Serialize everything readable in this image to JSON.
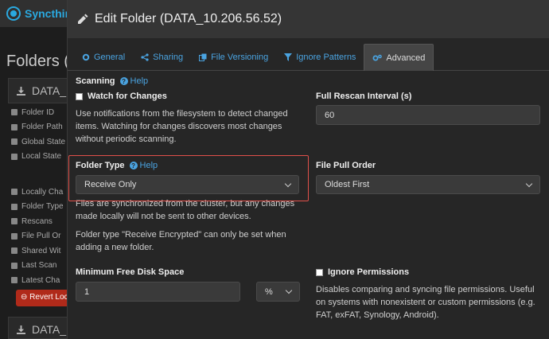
{
  "app": {
    "brand": "Syncthing"
  },
  "background": {
    "heading": "Folders (",
    "panel_title": "DATA_",
    "panel2_title": "DATA_",
    "items": [
      "Folder ID",
      "Folder Path",
      "Global State",
      "Local State",
      "Locally Cha",
      "Folder Type",
      "Rescans",
      "File Pull Or",
      "Shared Wit",
      "Last Scan",
      "Latest Cha"
    ],
    "revert_button": "Revert Loca"
  },
  "modal": {
    "title": "Edit Folder (DATA_10.206.56.52)",
    "tabs": [
      {
        "label": "General",
        "icon": "gear-icon"
      },
      {
        "label": "Sharing",
        "icon": "share-icon"
      },
      {
        "label": "File Versioning",
        "icon": "versions-icon"
      },
      {
        "label": "Ignore Patterns",
        "icon": "filter-icon"
      },
      {
        "label": "Advanced",
        "icon": "gears-icon"
      }
    ],
    "active_tab": "Advanced",
    "help": "Help",
    "scanning": {
      "heading": "Scanning",
      "watch_label": "Watch for Changes",
      "watch_checked": false,
      "watch_desc": "Use notifications from the filesystem to detect changed items. Watching for changes discovers most changes without periodic scanning."
    },
    "rescan": {
      "label": "Full Rescan Interval (s)",
      "value": "60"
    },
    "folder_type": {
      "label": "Folder Type",
      "value": "Receive Only",
      "desc": "Files are synchronized from the cluster, but any changes made locally will not be sent to other devices.",
      "note": "Folder type \"Receive Encrypted\" can only be set when adding a new folder."
    },
    "pull_order": {
      "label": "File Pull Order",
      "value": "Oldest First"
    },
    "min_disk": {
      "label": "Minimum Free Disk Space",
      "value": "1",
      "unit": "%"
    },
    "ignore_perms": {
      "label": "Ignore Permissions",
      "checked": false,
      "desc": "Disables comparing and syncing file permissions. Useful on systems with nonexistent or custom permissions (e.g. FAT, exFAT, Synology, Android)."
    }
  },
  "colors": {
    "accent": "#4aa3e0",
    "highlight": "#e0504a",
    "danger": "#b02a1a"
  }
}
